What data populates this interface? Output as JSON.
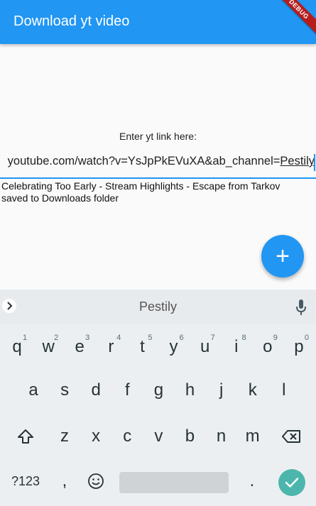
{
  "app": {
    "title": "Download yt video",
    "debug_banner": "DEBUG",
    "accent_color": "#2196f3"
  },
  "form": {
    "prompt": "Enter yt link here:",
    "link_prefix": "youtube.com/watch?v=YsJpPkEVuXA&ab_channel=",
    "link_composing": "Pestily"
  },
  "status": {
    "text": "Celebrating Too Early - Stream Highlights - Escape from Tarkov\nsaved to Downloads folder"
  },
  "fab": {
    "label": "+",
    "icon": "add-icon"
  },
  "keyboard": {
    "suggestion": "Pestily",
    "row1": [
      {
        "char": "q",
        "hint": "1"
      },
      {
        "char": "w",
        "hint": "2"
      },
      {
        "char": "e",
        "hint": "3"
      },
      {
        "char": "r",
        "hint": "4"
      },
      {
        "char": "t",
        "hint": "5"
      },
      {
        "char": "y",
        "hint": "6"
      },
      {
        "char": "u",
        "hint": "7"
      },
      {
        "char": "i",
        "hint": "8"
      },
      {
        "char": "o",
        "hint": "9"
      },
      {
        "char": "p",
        "hint": "0"
      }
    ],
    "row2": [
      "a",
      "s",
      "d",
      "f",
      "g",
      "h",
      "j",
      "k",
      "l"
    ],
    "row3": [
      "z",
      "x",
      "c",
      "v",
      "b",
      "n",
      "m"
    ],
    "symbols_label": "?123",
    "comma": ",",
    "period": ".",
    "enter_color": "#4db6ac"
  }
}
